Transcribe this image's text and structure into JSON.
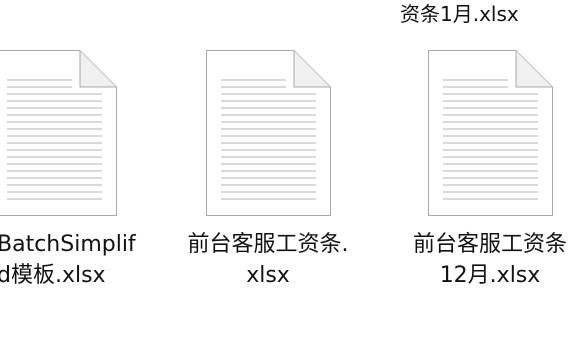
{
  "top_caption": "资条1月.xlsx",
  "files": [
    {
      "name_line1": "BatchSimplif",
      "name_line2": "d模板.xlsx",
      "icon": "document-icon"
    },
    {
      "name_line1": "前台客服工资条.",
      "name_line2": "xlsx",
      "icon": "document-icon"
    },
    {
      "name_line1": "前台客服工资条",
      "name_line2": "12月.xlsx",
      "icon": "document-icon"
    }
  ]
}
